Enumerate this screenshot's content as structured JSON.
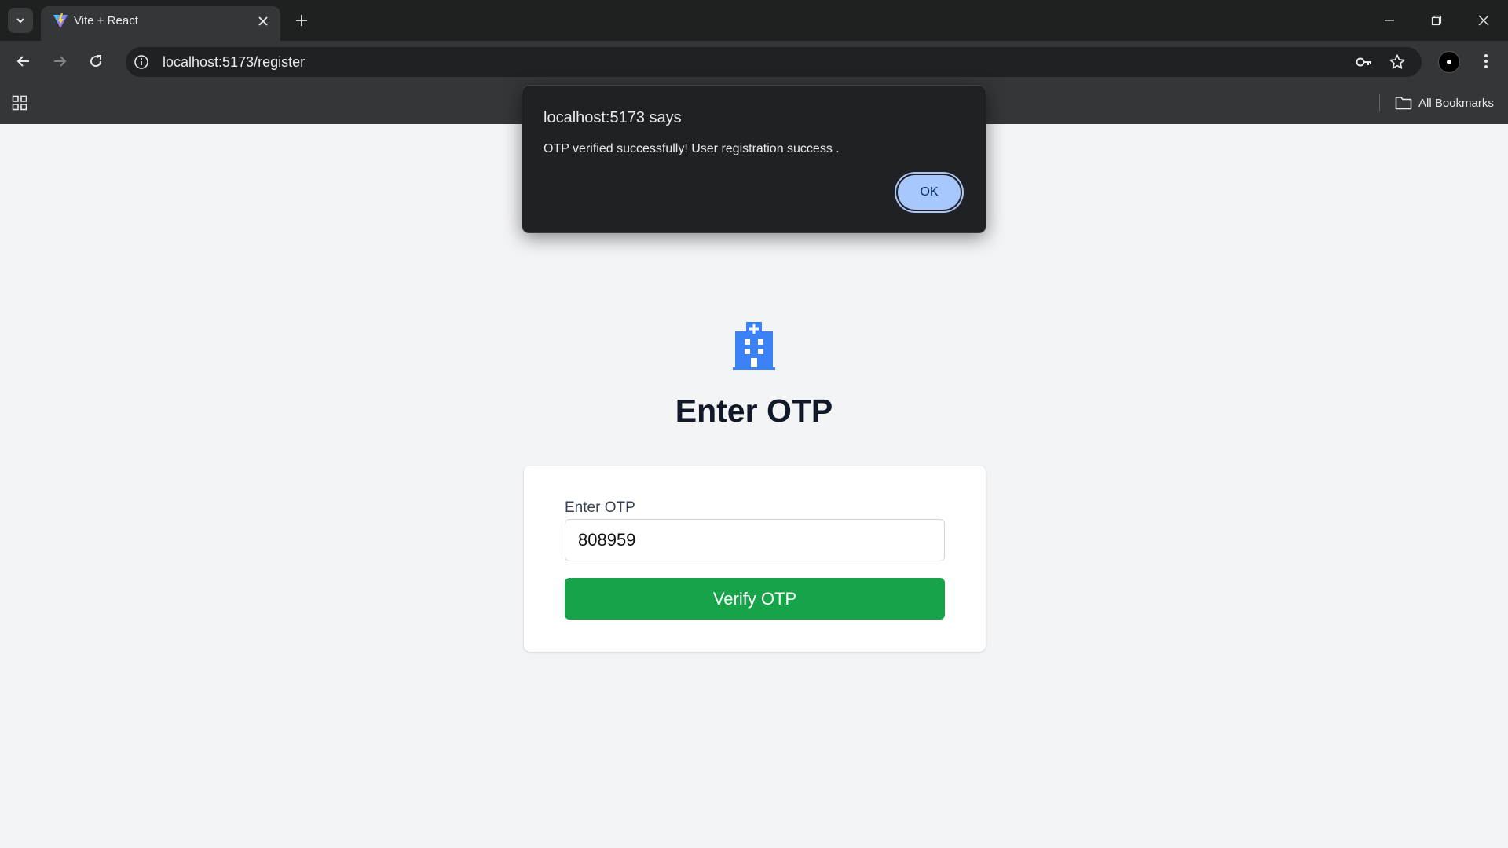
{
  "browser": {
    "tab_title": "Vite + React",
    "url": "localhost:5173/register",
    "bookmarks_label": "All Bookmarks",
    "icons": [
      "tab-search-icon",
      "vite-favicon",
      "close-icon",
      "plus-icon",
      "minimize-icon",
      "restore-icon",
      "window-close-icon",
      "back-arrow-icon",
      "forward-arrow-icon",
      "reload-icon",
      "site-info-icon",
      "password-key-icon",
      "star-icon",
      "profile-avatar",
      "more-vert-icon",
      "apps-grid-icon",
      "folder-icon"
    ]
  },
  "page": {
    "icon": "hospital-icon",
    "title": "Enter OTP",
    "form": {
      "otp_label": "Enter OTP",
      "otp_value": "808959",
      "verify_label": "Verify OTP"
    }
  },
  "dialog": {
    "title": "localhost:5173 says",
    "message": "OTP verified successfully! User registration success .",
    "ok_label": "OK"
  },
  "colors": {
    "page_bg": "#f3f4f6",
    "accent_button": "#16a34a",
    "hospital_icon": "#3b82f6",
    "dialog_bg": "#202124",
    "dialog_ok": "#a8c7fa"
  }
}
